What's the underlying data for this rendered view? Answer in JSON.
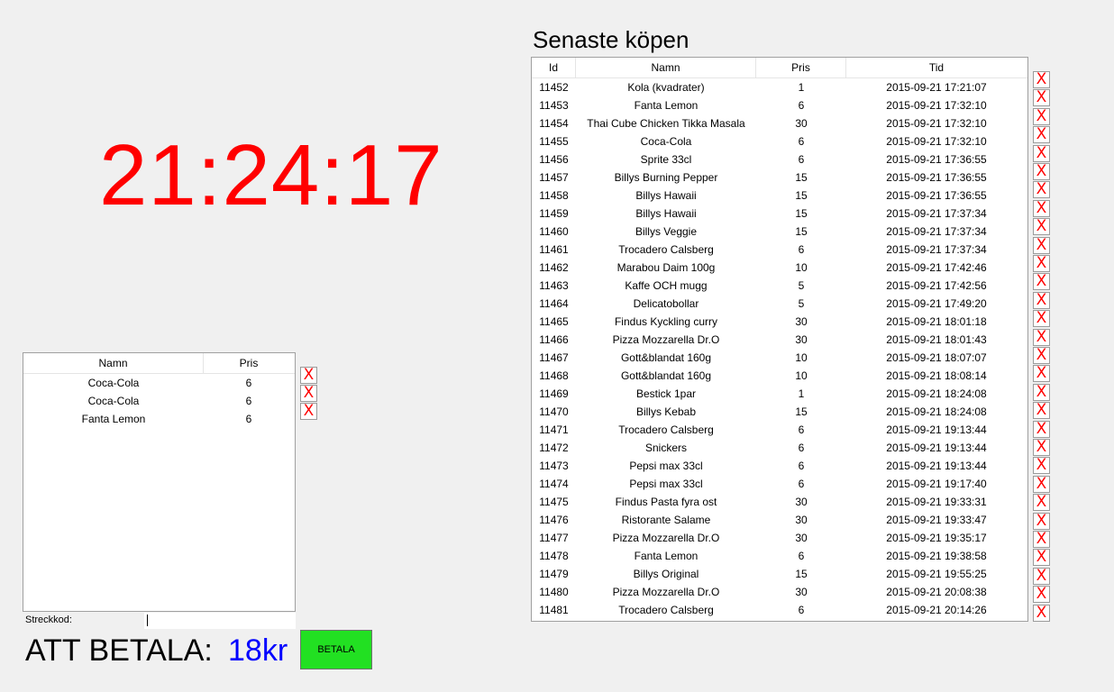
{
  "clock": "21:24:17",
  "cart": {
    "columns": [
      "Namn",
      "Pris"
    ],
    "rows": [
      {
        "name": "Coca-Cola",
        "price": "6"
      },
      {
        "name": "Coca-Cola",
        "price": "6"
      },
      {
        "name": "Fanta Lemon",
        "price": "6"
      }
    ]
  },
  "remove_label": "X",
  "barcode": {
    "label": "Streckkod:",
    "value": ""
  },
  "payment": {
    "label": "ATT BETALA:",
    "amount": "18kr",
    "button_label": "BETALA"
  },
  "recent": {
    "title": "Senaste köpen",
    "columns": [
      "Id",
      "Namn",
      "Pris",
      "Tid"
    ],
    "rows": [
      {
        "id": "11452",
        "name": "Kola (kvadrater)",
        "price": "1",
        "time": "2015-09-21 17:21:07"
      },
      {
        "id": "11453",
        "name": "Fanta Lemon",
        "price": "6",
        "time": "2015-09-21 17:32:10"
      },
      {
        "id": "11454",
        "name": "Thai Cube Chicken Tikka Masala",
        "price": "30",
        "time": "2015-09-21 17:32:10"
      },
      {
        "id": "11455",
        "name": "Coca-Cola",
        "price": "6",
        "time": "2015-09-21 17:32:10"
      },
      {
        "id": "11456",
        "name": "Sprite 33cl",
        "price": "6",
        "time": "2015-09-21 17:36:55"
      },
      {
        "id": "11457",
        "name": "Billys Burning Pepper",
        "price": "15",
        "time": "2015-09-21 17:36:55"
      },
      {
        "id": "11458",
        "name": "Billys Hawaii",
        "price": "15",
        "time": "2015-09-21 17:36:55"
      },
      {
        "id": "11459",
        "name": "Billys Hawaii",
        "price": "15",
        "time": "2015-09-21 17:37:34"
      },
      {
        "id": "11460",
        "name": "Billys Veggie",
        "price": "15",
        "time": "2015-09-21 17:37:34"
      },
      {
        "id": "11461",
        "name": "Trocadero Calsberg",
        "price": "6",
        "time": "2015-09-21 17:37:34"
      },
      {
        "id": "11462",
        "name": "Marabou Daim 100g",
        "price": "10",
        "time": "2015-09-21 17:42:46"
      },
      {
        "id": "11463",
        "name": "Kaffe OCH mugg",
        "price": "5",
        "time": "2015-09-21 17:42:56"
      },
      {
        "id": "11464",
        "name": "Delicatobollar",
        "price": "5",
        "time": "2015-09-21 17:49:20"
      },
      {
        "id": "11465",
        "name": "Findus Kyckling curry",
        "price": "30",
        "time": "2015-09-21 18:01:18"
      },
      {
        "id": "11466",
        "name": "Pizza Mozzarella Dr.O",
        "price": "30",
        "time": "2015-09-21 18:01:43"
      },
      {
        "id": "11467",
        "name": "Gott&blandat 160g",
        "price": "10",
        "time": "2015-09-21 18:07:07"
      },
      {
        "id": "11468",
        "name": "Gott&blandat 160g",
        "price": "10",
        "time": "2015-09-21 18:08:14"
      },
      {
        "id": "11469",
        "name": "Bestick 1par",
        "price": "1",
        "time": "2015-09-21 18:24:08"
      },
      {
        "id": "11470",
        "name": "Billys Kebab",
        "price": "15",
        "time": "2015-09-21 18:24:08"
      },
      {
        "id": "11471",
        "name": "Trocadero Calsberg",
        "price": "6",
        "time": "2015-09-21 19:13:44"
      },
      {
        "id": "11472",
        "name": "Snickers",
        "price": "6",
        "time": "2015-09-21 19:13:44"
      },
      {
        "id": "11473",
        "name": "Pepsi max 33cl",
        "price": "6",
        "time": "2015-09-21 19:13:44"
      },
      {
        "id": "11474",
        "name": "Pepsi max 33cl",
        "price": "6",
        "time": "2015-09-21 19:17:40"
      },
      {
        "id": "11475",
        "name": "Findus Pasta fyra ost",
        "price": "30",
        "time": "2015-09-21 19:33:31"
      },
      {
        "id": "11476",
        "name": "Ristorante Salame",
        "price": "30",
        "time": "2015-09-21 19:33:47"
      },
      {
        "id": "11477",
        "name": "Pizza Mozzarella Dr.O",
        "price": "30",
        "time": "2015-09-21 19:35:17"
      },
      {
        "id": "11478",
        "name": "Fanta Lemon",
        "price": "6",
        "time": "2015-09-21 19:38:58"
      },
      {
        "id": "11479",
        "name": "Billys Original",
        "price": "15",
        "time": "2015-09-21 19:55:25"
      },
      {
        "id": "11480",
        "name": "Pizza Mozzarella Dr.O",
        "price": "30",
        "time": "2015-09-21 20:08:38"
      },
      {
        "id": "11481",
        "name": "Trocadero Calsberg",
        "price": "6",
        "time": "2015-09-21 20:14:26"
      }
    ]
  }
}
